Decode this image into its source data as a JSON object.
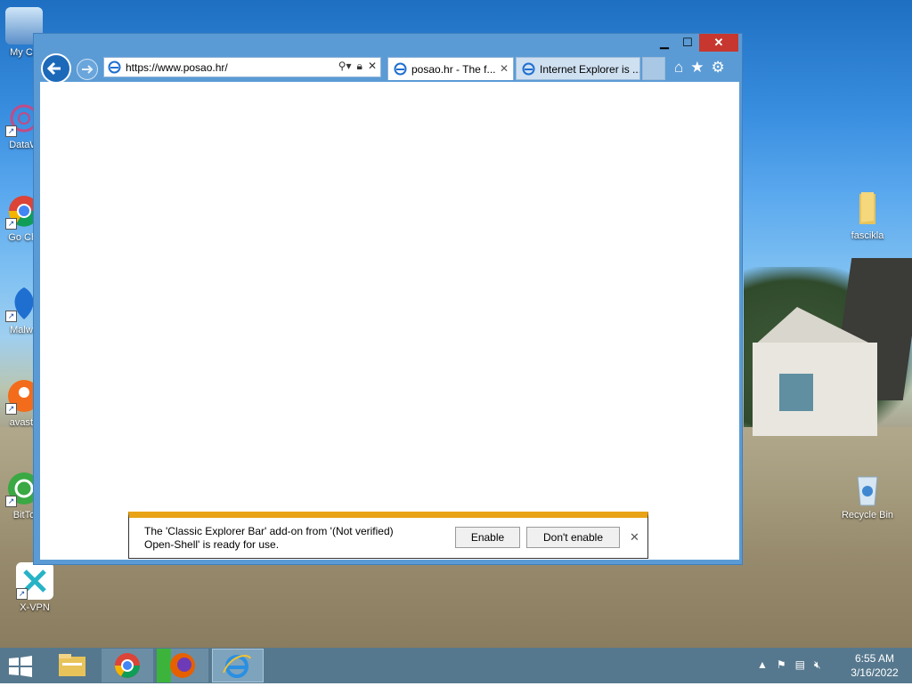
{
  "desktop_icons": [
    {
      "label": "My Co"
    },
    {
      "label": "DataW"
    },
    {
      "label": "Go Chr"
    },
    {
      "label": "Malwa"
    },
    {
      "label": "avast_"
    },
    {
      "label": "BitTo"
    },
    {
      "label": "X-VPN"
    },
    {
      "label": "fascikla"
    },
    {
      "label": "Recycle Bin"
    }
  ],
  "browser": {
    "address_url": "https://www.posao.hr/",
    "tabs": [
      {
        "title": "posao.hr - The f...",
        "active": true
      },
      {
        "title": "Internet Explorer is ...",
        "active": false
      }
    ],
    "caption": {
      "minimize": "▁",
      "maximize": "☐",
      "close": "✕"
    }
  },
  "notification": {
    "message_line1": "The 'Classic Explorer Bar' add-on from '(Not verified)",
    "message_line2": "Open-Shell' is ready for use.",
    "enable_label": "Enable",
    "dont_enable_label": "Don't enable",
    "close_glyph": "✕"
  },
  "taskbar": {
    "time": "6:55 AM",
    "date": "3/16/2022"
  },
  "colors": {
    "window_frame": "#5b9bd5",
    "close_button": "#c7372f",
    "notify_accent": "#e8a317",
    "taskbar": "#56788e"
  }
}
